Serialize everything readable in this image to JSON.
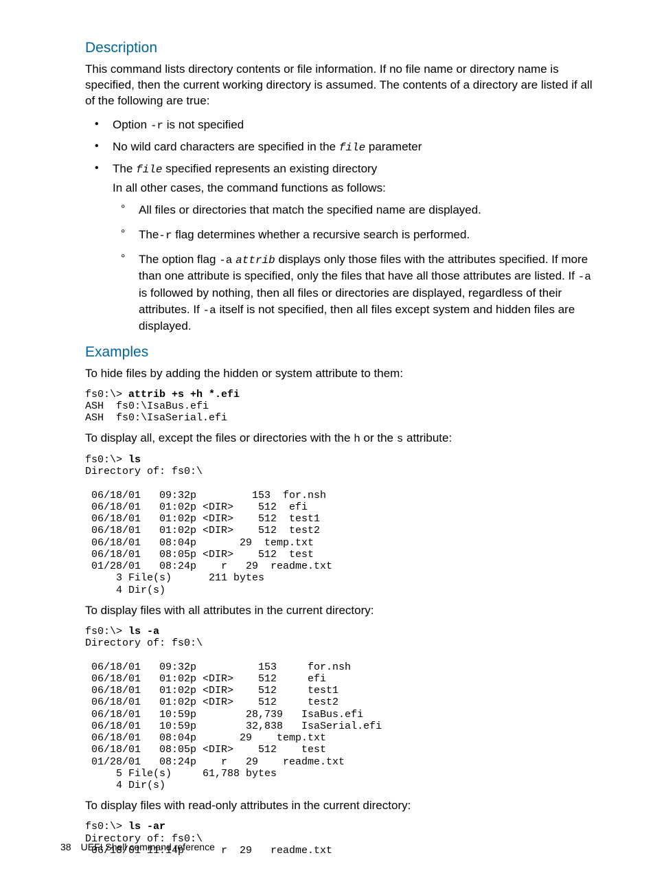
{
  "sections": {
    "description": {
      "heading": "Description",
      "intro": "This command lists directory contents or file information. If no file name or directory name is specified, then the current working directory is assumed. The contents of a directory are listed if all of the following are true:",
      "bullets": {
        "b1_a": "Option ",
        "b1_code": "-r",
        "b1_b": " is not specified",
        "b2_a": "No wild card characters are specified in the ",
        "b2_code": "file",
        "b2_b": " parameter",
        "b3_a": "The ",
        "b3_code": "file",
        "b3_b": " specified represents an existing directory"
      },
      "sub_intro": "In all other cases, the command functions as follows:",
      "sub": {
        "s1": "All files or directories that match the specified name are displayed.",
        "s2_a": "The",
        "s2_code": "-r",
        "s2_b": " flag determines whether a recursive search is performed.",
        "s3_a": "The option flag ",
        "s3_code1": "-a",
        "s3_b": " ",
        "s3_code2": "attrib",
        "s3_c": " displays only those files with the attributes specified. If more than one attribute is specified, only the files that have all those attributes are listed. If ",
        "s3_code3": "-a",
        "s3_d": " is followed by nothing, then all files or directories are displayed, regardless of their attributes. If ",
        "s3_code4": "-a",
        "s3_e": " itself is not specified, then all files except system and hidden files are displayed."
      }
    },
    "examples": {
      "heading": "Examples",
      "p1": "To hide files by adding the hidden or system attribute to them:",
      "code1_prompt": "fs0:\\> ",
      "code1_cmd": "attrib +s +h *.efi",
      "code1_rest": "\nASH  fs0:\\IsaBus.efi\nASH  fs0:\\IsaSerial.efi",
      "p2_a": "To display all, except the files or directories with the ",
      "p2_code1": "h",
      "p2_b": " or the ",
      "p2_code2": "s",
      "p2_c": " attribute:",
      "code2_prompt": "fs0:\\> ",
      "code2_cmd": "ls",
      "code2_rest": "\nDirectory of: fs0:\\ \n\n 06/18/01   09:32p         153  for.nsh \n 06/18/01   01:02p <DIR>    512  efi \n 06/18/01   01:02p <DIR>    512  test1 \n 06/18/01   01:02p <DIR>    512  test2 \n 06/18/01   08:04p       29  temp.txt \n 06/18/01   08:05p <DIR>    512  test \n 01/28/01   08:24p    r   29  readme.txt \n     3 File(s)      211 bytes\n     4 Dir(s)",
      "p3": "To display files with all attributes in the current directory:",
      "code3_prompt": "fs0:\\> ",
      "code3_cmd": "ls -a",
      "code3_rest": "\nDirectory of: fs0:\\ \n\n 06/18/01   09:32p          153     for.nsh \n 06/18/01   01:02p <DIR>    512     efi \n 06/18/01   01:02p <DIR>    512     test1 \n 06/18/01   01:02p <DIR>    512     test2 \n 06/18/01   10:59p        28,739   IsaBus.efi \n 06/18/01   10:59p        32,838   IsaSerial.efi \n 06/18/01   08:04p       29    temp.txt \n 06/18/01   08:05p <DIR>    512    test \n 01/28/01   08:24p    r   29    readme.txt \n     5 File(s)     61,788 bytes\n     4 Dir(s)",
      "p4": "To display files with read-only attributes in the current directory:",
      "code4_prompt": "fs0:\\> ",
      "code4_cmd": "ls -ar",
      "code4_rest": "\nDirectory of: fs0:\\ \n 06/18/01 11:14p      r  29   readme.txt"
    }
  },
  "footer": {
    "page_number": "38",
    "title": "UEFI Shell command reference"
  }
}
